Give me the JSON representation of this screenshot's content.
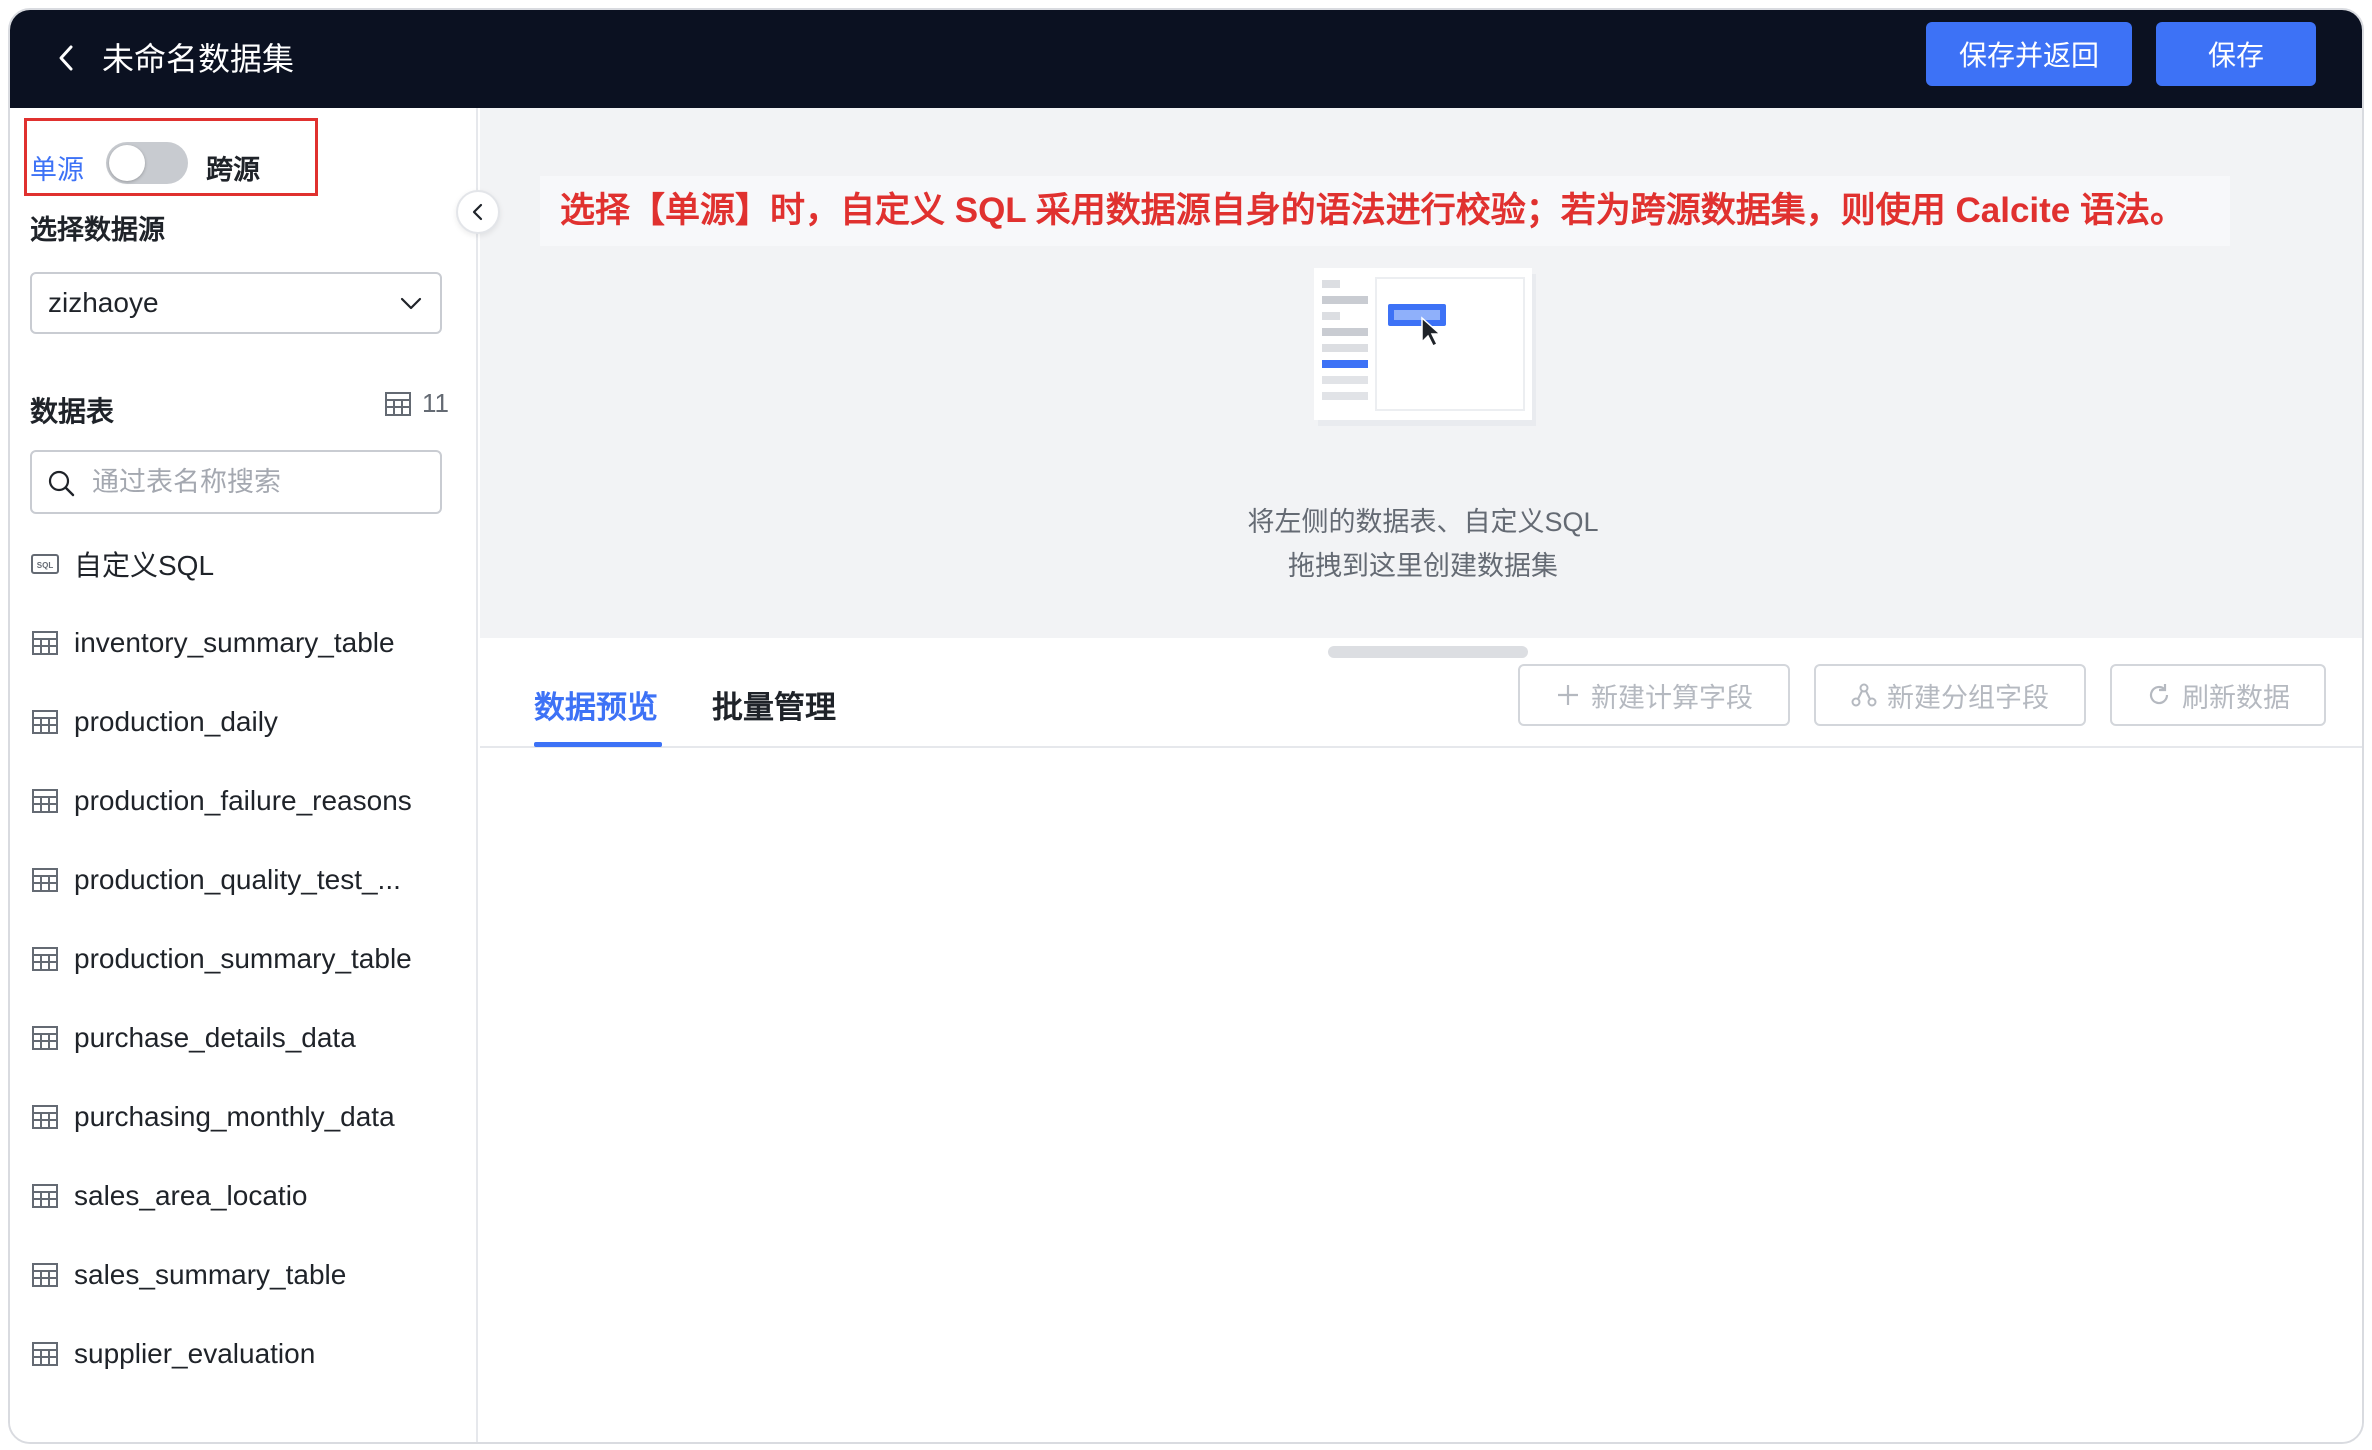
{
  "header": {
    "title": "未命名数据集",
    "save_return_label": "保存并返回",
    "save_label": "保存"
  },
  "sidebar": {
    "mode_single": "单源",
    "mode_cross": "跨源",
    "toggle_on": false,
    "datasource_label": "选择数据源",
    "datasource_value": "zizhaoye",
    "tables_label": "数据表",
    "tables_count": "11",
    "search_placeholder": "通过表名称搜索",
    "items": [
      {
        "label": "自定义SQL",
        "icon": "sql-icon"
      },
      {
        "label": "inventory_summary_table",
        "icon": "table-icon"
      },
      {
        "label": "production_daily",
        "icon": "table-icon"
      },
      {
        "label": "production_failure_reasons",
        "icon": "table-icon"
      },
      {
        "label": "production_quality_test_...",
        "icon": "table-icon"
      },
      {
        "label": "production_summary_table",
        "icon": "table-icon"
      },
      {
        "label": "purchase_details_data",
        "icon": "table-icon"
      },
      {
        "label": "purchasing_monthly_data",
        "icon": "table-icon"
      },
      {
        "label": "sales_area_locatio",
        "icon": "table-icon"
      },
      {
        "label": "sales_summary_table",
        "icon": "table-icon"
      },
      {
        "label": "supplier_evaluation",
        "icon": "table-icon"
      }
    ]
  },
  "main": {
    "banner_text": "选择【单源】时，自定义 SQL 采用数据源自身的语法进行校验；若为跨源数据集，则使用 Calcite 语法。",
    "empty_line1": "将左侧的数据表、自定义SQL",
    "empty_line2": "拖拽到这里创建数据集",
    "tabs": [
      {
        "label": "数据预览",
        "active": true
      },
      {
        "label": "批量管理",
        "active": false
      }
    ],
    "actions": {
      "new_calc_field": "新建计算字段",
      "new_group_field": "新建分组字段",
      "refresh_data": "刷新数据"
    }
  },
  "colors": {
    "header_bg": "#0b1121",
    "primary": "#3d72f6",
    "annotation_red": "#e0312f"
  }
}
